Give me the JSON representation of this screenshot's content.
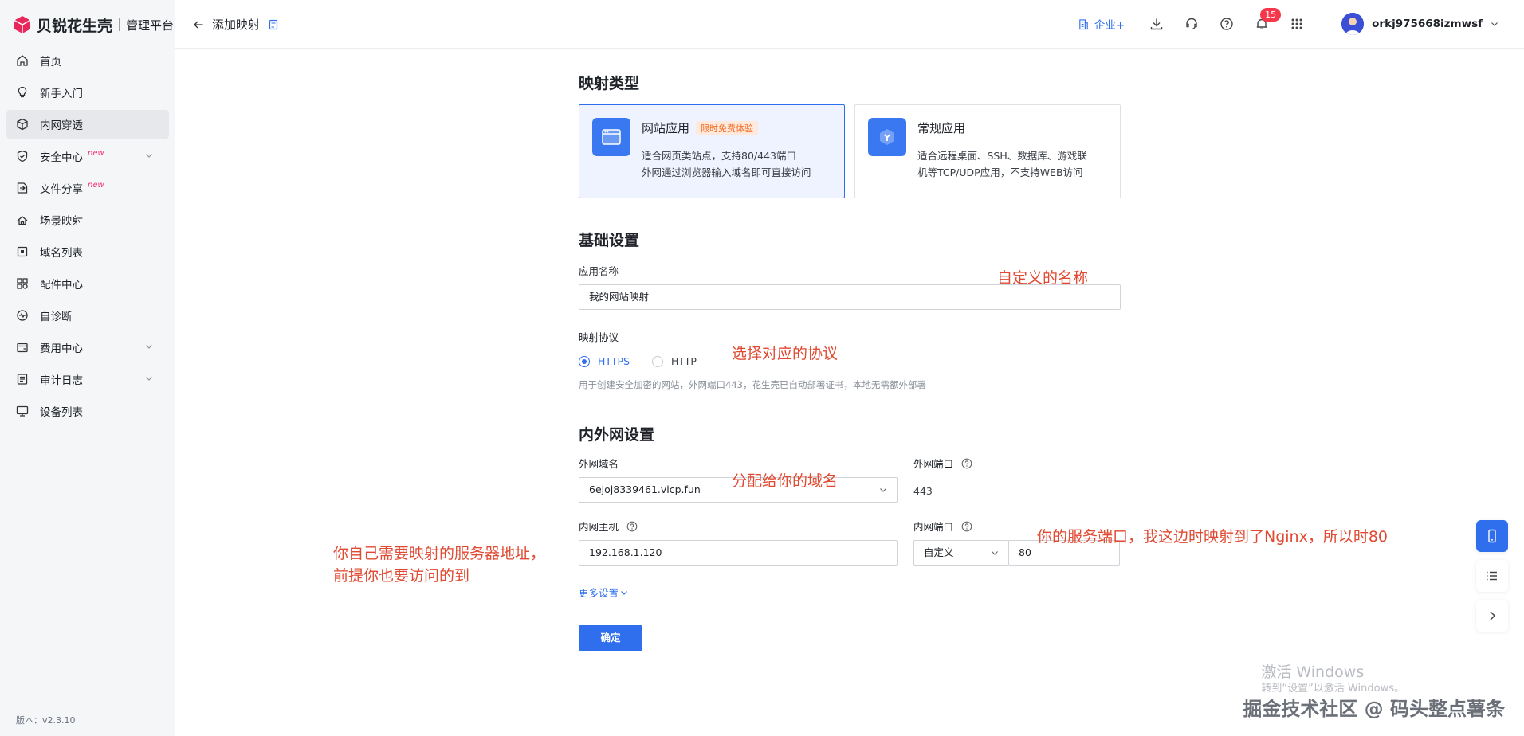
{
  "brand": {
    "name": "贝锐花生壳",
    "sub": "管理平台",
    "logo_color": "#e8275a"
  },
  "sidebar": {
    "items": [
      {
        "label": "首页",
        "icon": "home-icon"
      },
      {
        "label": "新手入门",
        "icon": "lightbulb-icon"
      },
      {
        "label": "内网穿透",
        "icon": "cube-icon",
        "active": true
      },
      {
        "label": "安全中心",
        "icon": "shield-icon",
        "badge": "new",
        "expandable": true
      },
      {
        "label": "文件分享",
        "icon": "file-share-icon",
        "badge": "new"
      },
      {
        "label": "场景映射",
        "icon": "scene-icon"
      },
      {
        "label": "域名列表",
        "icon": "domain-icon"
      },
      {
        "label": "配件中心",
        "icon": "grid-icon"
      },
      {
        "label": "自诊断",
        "icon": "diagnose-icon"
      },
      {
        "label": "费用中心",
        "icon": "wallet-icon",
        "expandable": true
      },
      {
        "label": "审计日志",
        "icon": "log-icon",
        "expandable": true
      },
      {
        "label": "设备列表",
        "icon": "monitor-icon"
      }
    ],
    "version_label": "版本：",
    "version": "v2.3.10"
  },
  "header": {
    "title": "添加映射",
    "business": "企业+",
    "notifications": "15",
    "username": "orkj975668izmwsf"
  },
  "form": {
    "section_type": "映射类型",
    "cards": [
      {
        "title": "网站应用",
        "tag": "限时免费体验",
        "desc1": "适合网页类站点，支持80/443端口",
        "desc2": "外网通过浏览器输入域名即可直接访问",
        "selected": true
      },
      {
        "title": "常规应用",
        "tag": "",
        "desc1": "适合远程桌面、SSH、数据库、游戏联",
        "desc2": "机等TCP/UDP应用，不支持WEB访问",
        "selected": false
      }
    ],
    "section_basic": "基础设置",
    "app_name_label": "应用名称",
    "app_name_value": "我的网站映射",
    "protocol_label": "映射协议",
    "protocol_options": [
      "HTTPS",
      "HTTP"
    ],
    "protocol_selected": "HTTPS",
    "protocol_hint": "用于创建安全加密的网站，外网端口443，花生壳已自动部署证书，本地无需额外部署",
    "section_net": "内外网设置",
    "ext_domain_label": "外网域名",
    "ext_domain_value": "6ejoj8339461.vicp.fun",
    "ext_port_label": "外网端口",
    "ext_port_value": "443",
    "int_host_label": "内网主机",
    "int_host_value": "192.168.1.120",
    "int_port_label": "内网端口",
    "int_port_mode": "自定义",
    "int_port_value": "80",
    "more_settings": "更多设置",
    "submit": "确定"
  },
  "annotations": {
    "name": "自定义的名称",
    "protocol": "选择对应的协议",
    "domain": "分配给你的域名",
    "port": "你的服务端口，我这边时映射到了Nginx，所以时80",
    "host_line1": "你自己需要映射的服务器地址，",
    "host_line2": "前提你也要访问的到"
  },
  "watermark": {
    "line1": "激活 Windows",
    "line2": "转到“设置”以激活 Windows。"
  },
  "credit": "掘金技术社区 @ 码头整点薯条",
  "colors": {
    "primary": "#2f6fed",
    "annotation": "#e04a32",
    "badge": "#f5364b"
  }
}
